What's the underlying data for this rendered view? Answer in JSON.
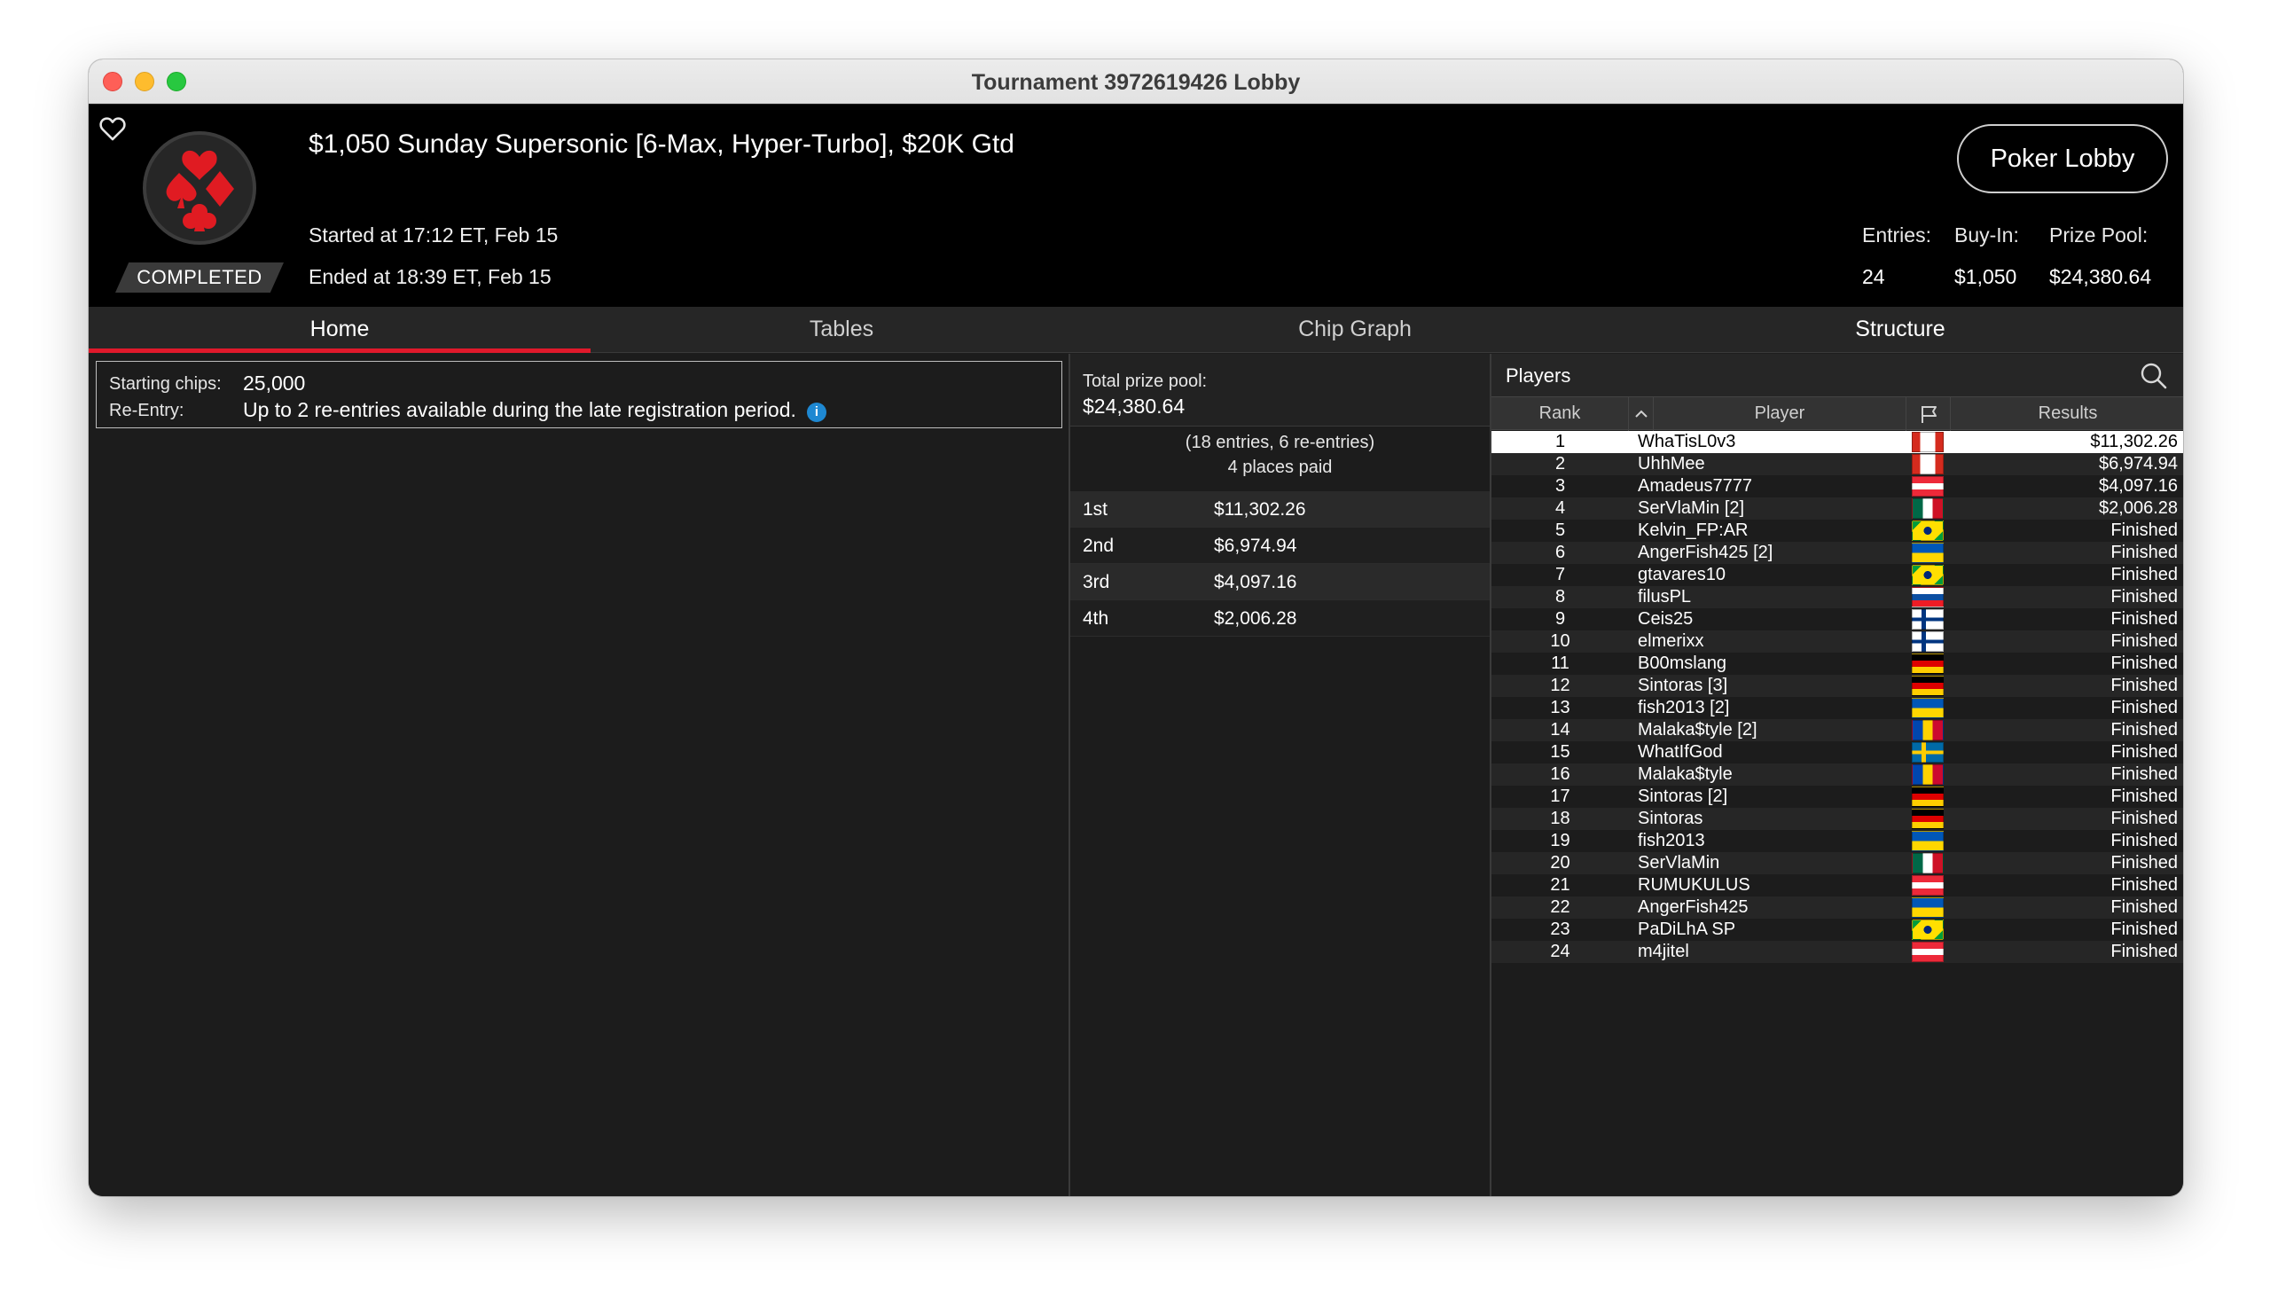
{
  "window": {
    "title": "Tournament 3972619426 Lobby"
  },
  "header": {
    "tournament_name": "$1,050 Sunday Supersonic [6-Max, Hyper-Turbo], $20K Gtd",
    "started": "Started at 17:12 ET, Feb 15",
    "ended": "Ended at 18:39 ET, Feb 15",
    "status": "COMPLETED",
    "poker_lobby_label": "Poker Lobby",
    "stats": {
      "entries_label": "Entries:",
      "entries_value": "24",
      "buyin_label": "Buy-In:",
      "buyin_value": "$1,050",
      "prizepool_label": "Prize Pool:",
      "prizepool_value": "$24,380.64"
    },
    "icons": {
      "favorite": "heart-outline-icon",
      "logo": "card-suits-logo"
    },
    "colors": {
      "accent": "#e0192b",
      "logo_red": "#e01b22"
    }
  },
  "tabs": [
    {
      "label": "Home",
      "active": true
    },
    {
      "label": "Tables",
      "active": false
    },
    {
      "label": "Chip Graph",
      "active": false
    },
    {
      "label": "Structure",
      "active": false
    }
  ],
  "home": {
    "starting_chips_label": "Starting chips:",
    "starting_chips_value": "25,000",
    "reentry_label": "Re-Entry:",
    "reentry_value": "Up to 2 re-entries available during the late registration period.",
    "info_icon": "i"
  },
  "prize": {
    "total_label": "Total prize pool:",
    "total_value": "$24,380.64",
    "entries_line": "(18 entries, 6 re-entries)",
    "places_line": "4 places paid",
    "payouts": [
      {
        "place": "1st",
        "amount": "$11,302.26"
      },
      {
        "place": "2nd",
        "amount": "$6,974.94"
      },
      {
        "place": "3rd",
        "amount": "$4,097.16"
      },
      {
        "place": "4th",
        "amount": "$2,006.28"
      }
    ]
  },
  "players": {
    "title": "Players",
    "columns": {
      "rank": "Rank",
      "player": "Player",
      "results": "Results"
    },
    "sort_indicator": "^",
    "rows": [
      {
        "rank": "1",
        "name": "WhaTisL0v3",
        "flag": "canada",
        "result": "$11,302.26"
      },
      {
        "rank": "2",
        "name": "UhhMee",
        "flag": "canada",
        "result": "$6,974.94"
      },
      {
        "rank": "3",
        "name": "Amadeus7777",
        "flag": "austria",
        "result": "$4,097.16"
      },
      {
        "rank": "4",
        "name": "SerVlaMin [2]",
        "flag": "mexico",
        "result": "$2,006.28"
      },
      {
        "rank": "5",
        "name": "Kelvin_FP:AR",
        "flag": "brazil",
        "result": "Finished"
      },
      {
        "rank": "6",
        "name": "AngerFish425 [2]",
        "flag": "ukraine",
        "result": "Finished"
      },
      {
        "rank": "7",
        "name": "gtavares10",
        "flag": "brazil",
        "result": "Finished"
      },
      {
        "rank": "8",
        "name": "filusPL",
        "flag": "slovakia",
        "result": "Finished"
      },
      {
        "rank": "9",
        "name": "Ceis25",
        "flag": "finland",
        "result": "Finished"
      },
      {
        "rank": "10",
        "name": "elmerixx",
        "flag": "finland",
        "result": "Finished"
      },
      {
        "rank": "11",
        "name": "B00mslang",
        "flag": "germany",
        "result": "Finished"
      },
      {
        "rank": "12",
        "name": "Sintoras [3]",
        "flag": "germany",
        "result": "Finished"
      },
      {
        "rank": "13",
        "name": "fish2013 [2]",
        "flag": "ukraine",
        "result": "Finished"
      },
      {
        "rank": "14",
        "name": "Malaka$tyle [2]",
        "flag": "moldova",
        "result": "Finished"
      },
      {
        "rank": "15",
        "name": "WhatIfGod",
        "flag": "sweden",
        "result": "Finished"
      },
      {
        "rank": "16",
        "name": "Malaka$tyle",
        "flag": "moldova",
        "result": "Finished"
      },
      {
        "rank": "17",
        "name": "Sintoras [2]",
        "flag": "germany",
        "result": "Finished"
      },
      {
        "rank": "18",
        "name": "Sintoras",
        "flag": "germany",
        "result": "Finished"
      },
      {
        "rank": "19",
        "name": "fish2013",
        "flag": "ukraine",
        "result": "Finished"
      },
      {
        "rank": "20",
        "name": "SerVlaMin",
        "flag": "mexico",
        "result": "Finished"
      },
      {
        "rank": "21",
        "name": "RUMUKULUS",
        "flag": "austria",
        "result": "Finished"
      },
      {
        "rank": "22",
        "name": "AngerFish425",
        "flag": "ukraine",
        "result": "Finished"
      },
      {
        "rank": "23",
        "name": "PaDiLhA SP",
        "flag": "brazil",
        "result": "Finished"
      },
      {
        "rank": "24",
        "name": "m4jitel",
        "flag": "austria",
        "result": "Finished"
      }
    ]
  }
}
